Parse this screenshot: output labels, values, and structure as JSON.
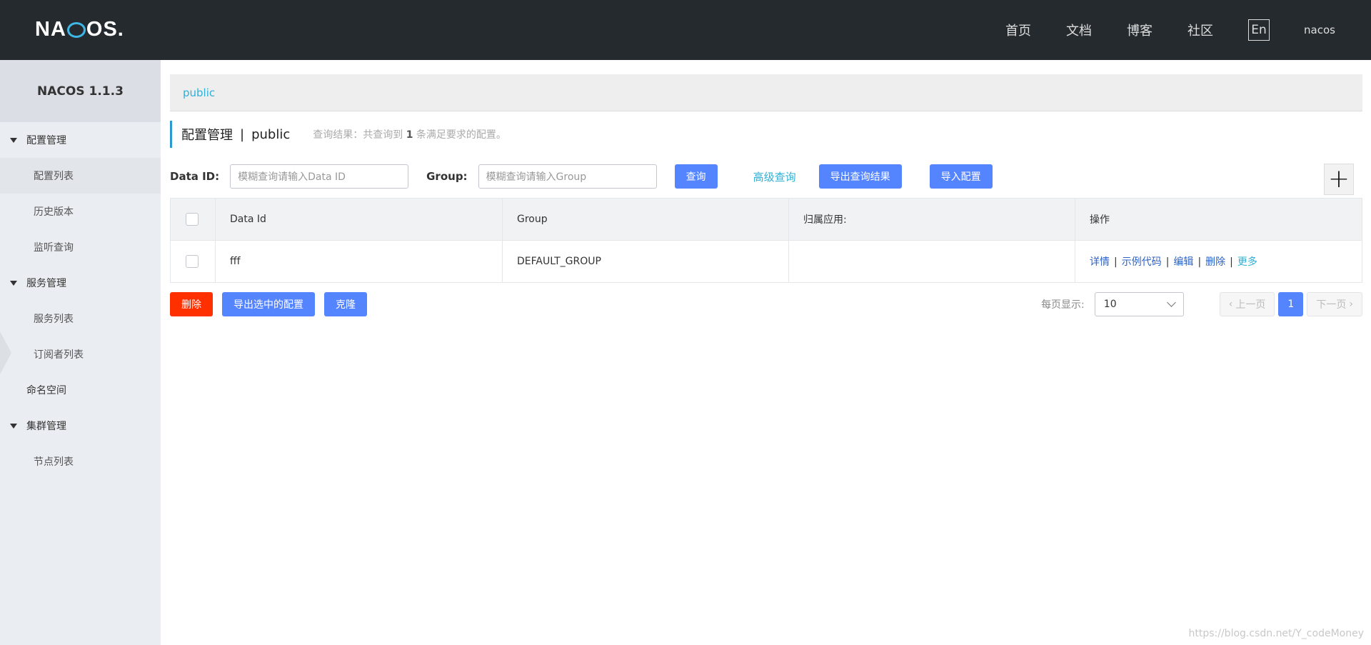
{
  "header": {
    "logo_text_1": "NA",
    "logo_text_2": "OS.",
    "nav": [
      "首页",
      "文档",
      "博客",
      "社区"
    ],
    "lang": "En",
    "user": "nacos"
  },
  "sidebar": {
    "version": "NACOS 1.1.3",
    "groups": [
      {
        "label": "配置管理",
        "items": [
          "配置列表",
          "历史版本",
          "监听查询"
        ]
      },
      {
        "label": "服务管理",
        "items": [
          "服务列表",
          "订阅者列表"
        ]
      },
      {
        "label": "集群管理",
        "items": [
          "节点列表"
        ]
      }
    ],
    "namespace": "命名空间"
  },
  "main": {
    "breadcrumb": "public",
    "title": "配置管理",
    "title_sep": "|",
    "namespace": "public",
    "result_prefix": "查询结果：共查询到",
    "result_count": "1",
    "result_suffix": "条满足要求的配置。",
    "filters": {
      "dataid_label": "Data ID:",
      "dataid_placeholder": "模糊查询请输入Data ID",
      "group_label": "Group:",
      "group_placeholder": "模糊查询请输入Group",
      "query": "查询",
      "advanced": "高级查询",
      "export_result": "导出查询结果",
      "import": "导入配置"
    },
    "table": {
      "columns": [
        "Data Id",
        "Group",
        "归属应用:",
        "操作"
      ],
      "rows": [
        {
          "data_id": "fff",
          "group": "DEFAULT_GROUP",
          "app": ""
        }
      ],
      "ops": [
        "详情",
        "示例代码",
        "编辑",
        "删除",
        "更多"
      ]
    },
    "bottom": {
      "delete": "删除",
      "export_selected": "导出选中的配置",
      "clone": "克隆",
      "page_size_label": "每页显示:",
      "page_size": "10",
      "prev": "上一页",
      "current_page": "1",
      "next": "下一页"
    },
    "watermark": "https://blog.csdn.net/Y_codeMoney"
  }
}
